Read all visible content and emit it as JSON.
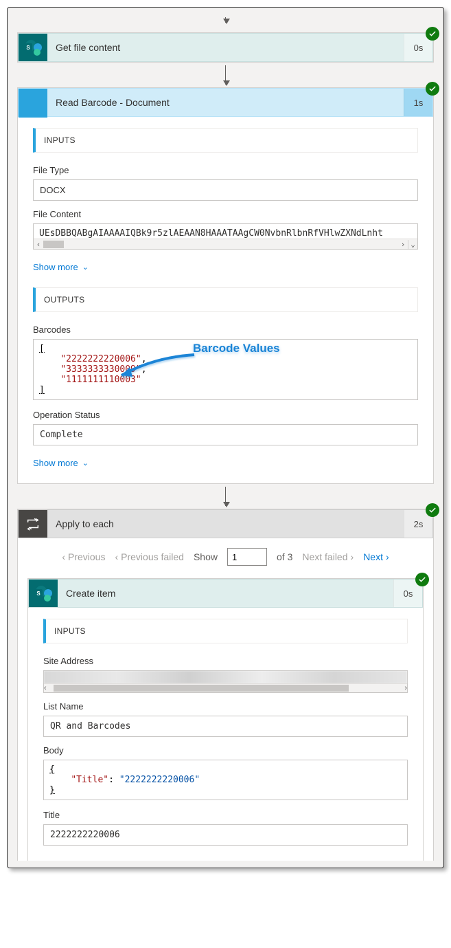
{
  "steps": {
    "getFile": {
      "title": "Get file content",
      "duration": "0s"
    },
    "readBarcode": {
      "title": "Read Barcode - Document",
      "duration": "1s"
    },
    "applyEach": {
      "title": "Apply to each",
      "duration": "2s"
    },
    "createItem": {
      "title": "Create item",
      "duration": "0s"
    }
  },
  "labels": {
    "inputs": "INPUTS",
    "outputs": "OUTPUTS",
    "showMore": "Show more"
  },
  "readBarcode": {
    "fileTypeLabel": "File Type",
    "fileTypeValue": "DOCX",
    "fileContentLabel": "File Content",
    "fileContentValue": "UEsDBBQABgAIAAAAIQBk9r5zlAEAAN8HAAATAAgCW0NvbnRlbnRfVHlwZXNdLnht",
    "barcodesLabel": "Barcodes",
    "barcodes": [
      "2222222220006",
      "3333333330009",
      "1111111110003"
    ],
    "opStatusLabel": "Operation Status",
    "opStatusValue": "Complete"
  },
  "callout": "Barcode Values",
  "pager": {
    "previous": "Previous",
    "previousFailed": "Previous failed",
    "show": "Show",
    "page": "1",
    "of": "of 3",
    "nextFailed": "Next failed",
    "next": "Next"
  },
  "createItem": {
    "siteAddressLabel": "Site Address",
    "listNameLabel": "List Name",
    "listNameValue": "QR and Barcodes",
    "bodyLabel": "Body",
    "bodyKey": "Title",
    "bodyValue": "2222222220006",
    "titleLabel": "Title",
    "titleValue": "2222222220006"
  }
}
